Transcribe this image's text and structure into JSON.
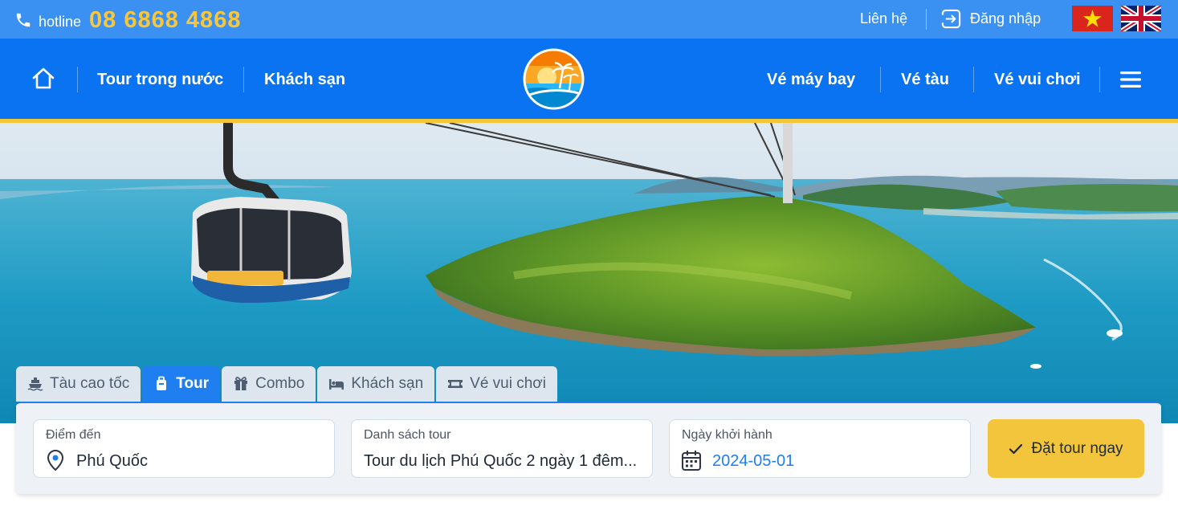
{
  "topbar": {
    "hotline_label": "hotline",
    "hotline_number": "08 6868 4868",
    "contact_link": "Liên hệ",
    "login_label": "Đăng nhập"
  },
  "nav": {
    "left_links": [
      "Tour trong nước",
      "Khách sạn"
    ],
    "right_links": [
      "Vé máy bay",
      "Vé tàu",
      "Vé vui chơi"
    ]
  },
  "tabs": [
    {
      "label": "Tàu cao tốc",
      "icon": "ship-icon",
      "active": false
    },
    {
      "label": "Tour",
      "icon": "luggage-icon",
      "active": true
    },
    {
      "label": "Combo",
      "icon": "gift-icon",
      "active": false
    },
    {
      "label": "Khách sạn",
      "icon": "bed-icon",
      "active": false
    },
    {
      "label": "Vé vui chơi",
      "icon": "ticket-icon",
      "active": false
    }
  ],
  "booking": {
    "destination_label": "Điểm đến",
    "destination_value": "Phú Quốc",
    "tour_list_label": "Danh sách tour",
    "tour_list_value": "Tour du lịch Phú Quốc 2 ngày 1 đêm...",
    "departure_label": "Ngày khởi hành",
    "departure_value": "2024-05-01",
    "submit_label": "Đặt tour ngay"
  },
  "colors": {
    "topbar": "#3a91f2",
    "nav": "#0a73f2",
    "accent_yellow": "#f2c636",
    "active_tab": "#1f7ef0"
  }
}
